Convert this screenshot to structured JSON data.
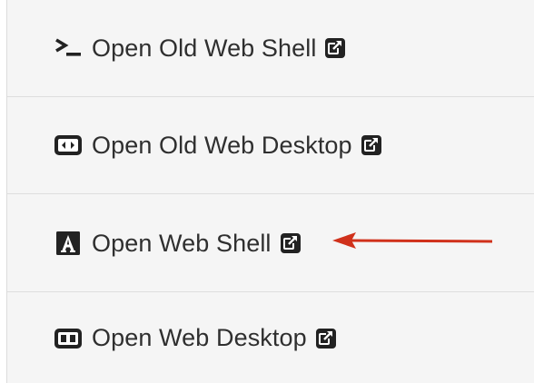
{
  "menu": {
    "items": [
      {
        "label": "Open Old Web Shell",
        "icon": "terminal-prompt-icon",
        "external_icon": "external-link-icon"
      },
      {
        "label": "Open Old Web Desktop",
        "icon": "remote-desktop-code-icon",
        "external_icon": "external-link-icon"
      },
      {
        "label": "Open Web Shell",
        "icon": "letter-a-square-icon",
        "external_icon": "external-link-icon"
      },
      {
        "label": "Open Web Desktop",
        "icon": "desktop-window-icon",
        "external_icon": "external-link-icon"
      }
    ]
  },
  "annotation": {
    "icon": "red-arrow-icon",
    "color": "#d0311b",
    "points_to": "Open Web Shell"
  },
  "colors": {
    "background": "#f5f5f5",
    "text": "#2f2f2f",
    "divider": "#dedede",
    "icon": "#222222"
  }
}
